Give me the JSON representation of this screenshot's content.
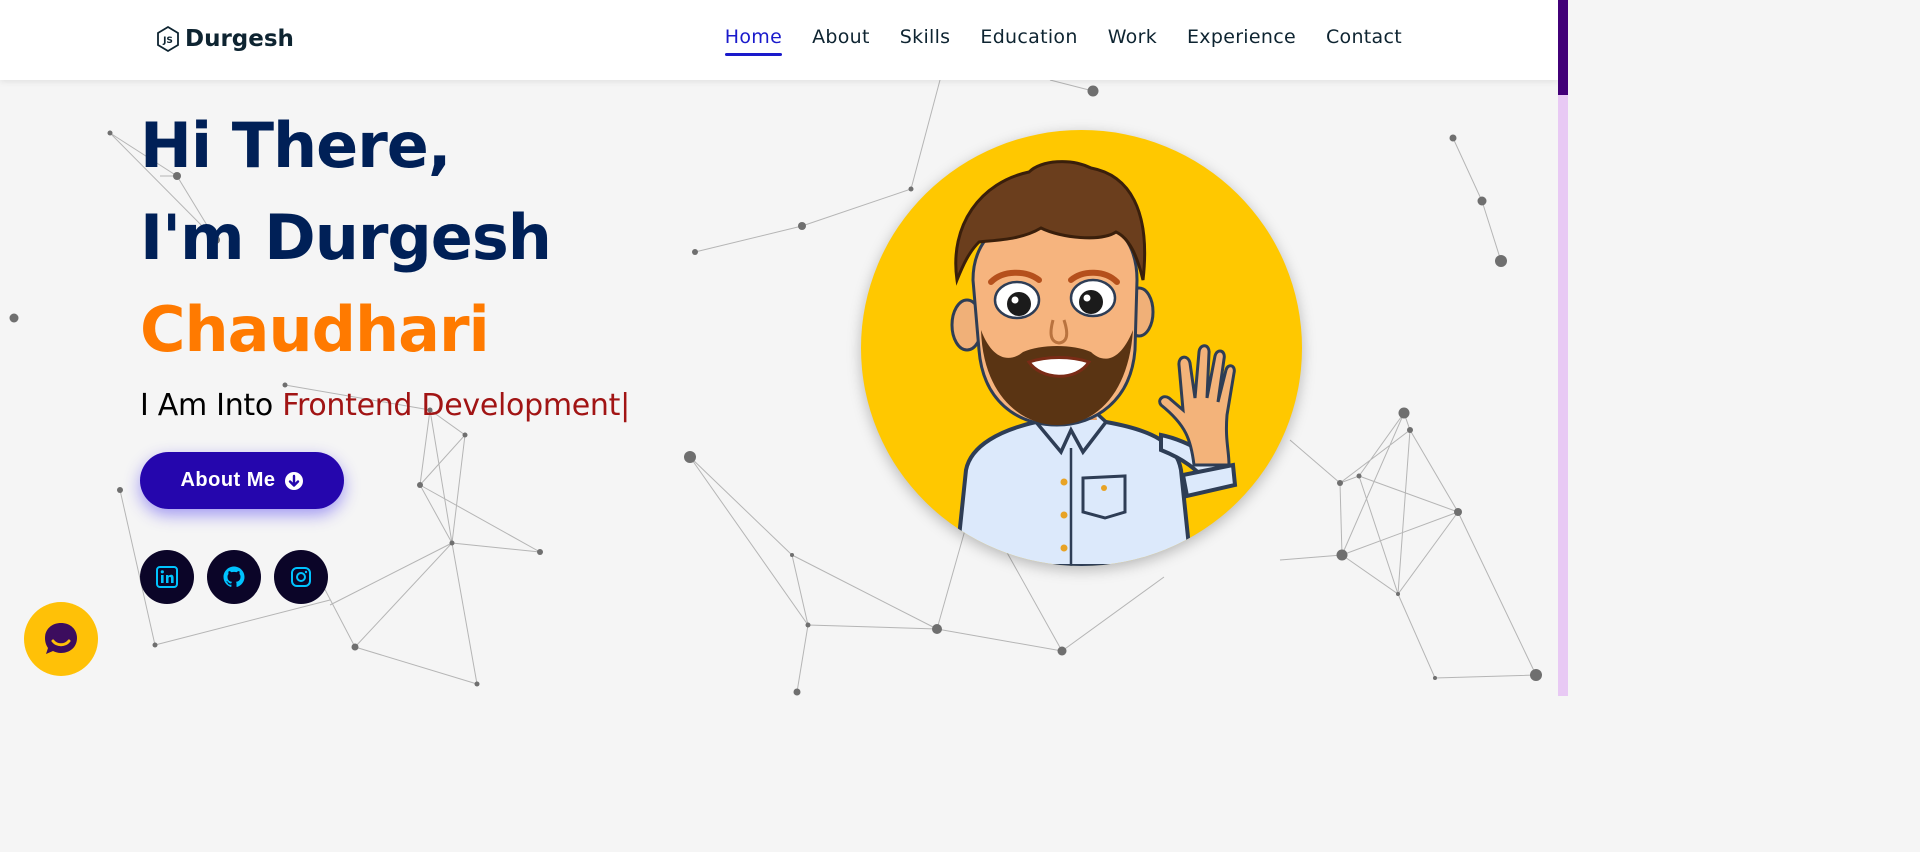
{
  "brand": {
    "logo_icon": "nodejs-hexagon-icon",
    "name": "Durgesh"
  },
  "nav": {
    "items": [
      {
        "label": "Home",
        "active": true
      },
      {
        "label": "About"
      },
      {
        "label": "Skills"
      },
      {
        "label": "Education"
      },
      {
        "label": "Work"
      },
      {
        "label": "Experience"
      },
      {
        "label": "Contact"
      }
    ]
  },
  "hero": {
    "line1": "Hi There,",
    "line2": "I'm Durgesh",
    "line3": "Chaudhari",
    "tagline_prefix": "I Am Into ",
    "tagline_typed": "Frontend Development|",
    "about_button": "About Me",
    "about_button_icon": "arrow-circle-down-icon"
  },
  "socials": [
    {
      "name": "linkedin",
      "icon": "linkedin-icon"
    },
    {
      "name": "github",
      "icon": "github-icon"
    },
    {
      "name": "instagram",
      "icon": "instagram-icon"
    }
  ],
  "avatar": {
    "description_icon": "waving-cartoon-avatar"
  },
  "chat": {
    "icon": "chat-bubble-icon"
  },
  "colors": {
    "navy": "#002057",
    "orange": "#ff7a00",
    "typed_red": "#a11414",
    "button_blue": "#2506ad",
    "active_nav": "#1a1acb",
    "avatar_bg": "#ffc800",
    "social_bg": "#0b0528",
    "social_icon": "#00c3ff",
    "chat_bg": "#ffc107"
  }
}
